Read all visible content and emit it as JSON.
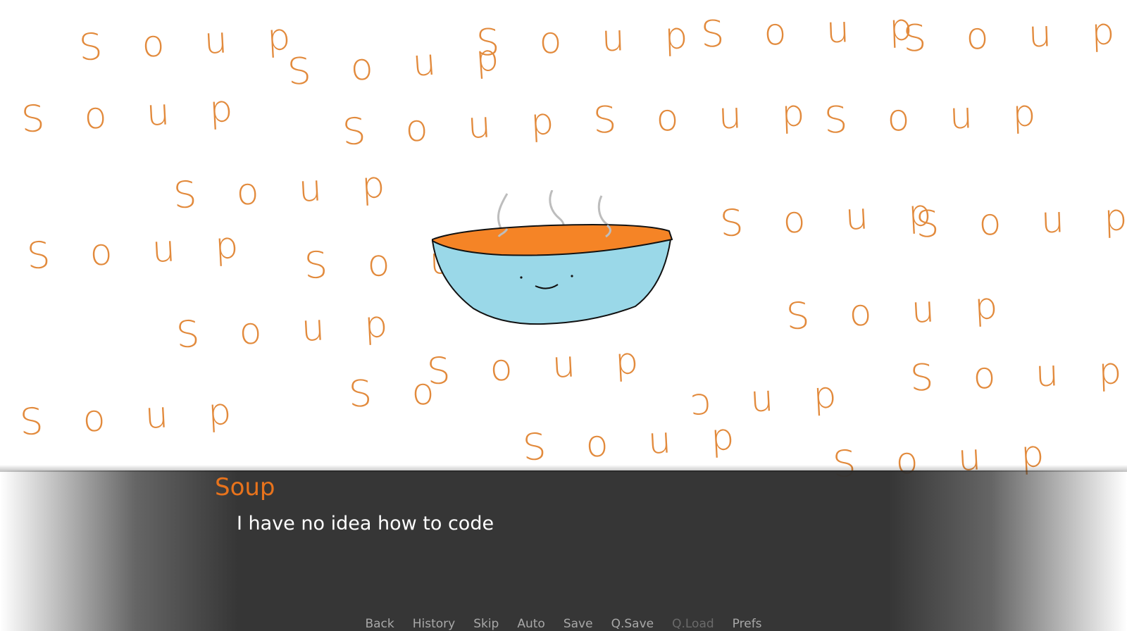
{
  "scene": {
    "background_word": "Soup",
    "word_color": "#e28a3c",
    "bowl_colors": {
      "soup": "#f58426",
      "bowl": "#9ad8e8",
      "steam": "#bdbdbd",
      "outline": "#111111"
    }
  },
  "dialogue": {
    "speaker": "Soup",
    "speaker_color": "#e8731c",
    "text": "I have no idea how to code"
  },
  "quick_menu": [
    {
      "label": "Back",
      "enabled": true
    },
    {
      "label": "History",
      "enabled": true
    },
    {
      "label": "Skip",
      "enabled": true
    },
    {
      "label": "Auto",
      "enabled": true
    },
    {
      "label": "Save",
      "enabled": true
    },
    {
      "label": "Q.Save",
      "enabled": true
    },
    {
      "label": "Q.Load",
      "enabled": false
    },
    {
      "label": "Prefs",
      "enabled": true
    }
  ]
}
